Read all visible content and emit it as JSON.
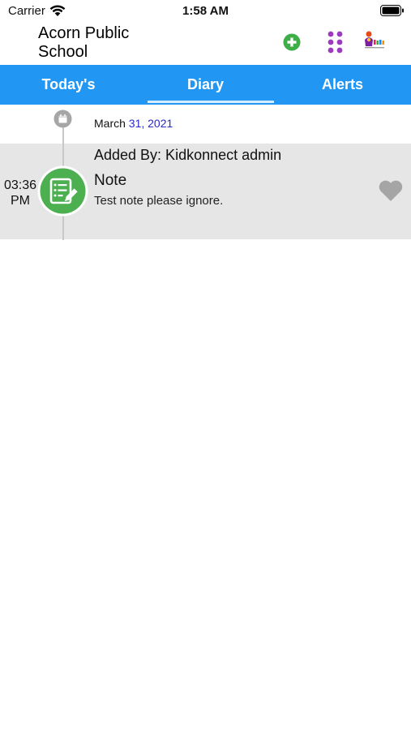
{
  "status_bar": {
    "carrier": "Carrier",
    "time": "1:58 AM",
    "icons": [
      "wifi-icon",
      "battery-icon"
    ]
  },
  "header": {
    "school_name": "Acorn Public School",
    "icons": [
      "add-circle-icon",
      "apps-grid-icon",
      "kidkonnect-logo-icon"
    ],
    "colors": {
      "add": "#3fae49",
      "grid": "#9c3bc1"
    }
  },
  "tabs": [
    {
      "label": "Today's",
      "active": false
    },
    {
      "label": "Diary",
      "active": true
    },
    {
      "label": "Alerts",
      "active": false
    }
  ],
  "tab_bar_color": "#2196f3",
  "diary": {
    "date_month": "March",
    "date_day_year": "31, 2021",
    "entries": [
      {
        "time": "03:36 PM",
        "added_by": "Added By: Kidkonnect admin",
        "type": "Note",
        "text": "Test note please ignore.",
        "icon": "note-edit-icon",
        "icon_color": "#4caf50",
        "favorite_icon": "heart-icon"
      }
    ]
  }
}
